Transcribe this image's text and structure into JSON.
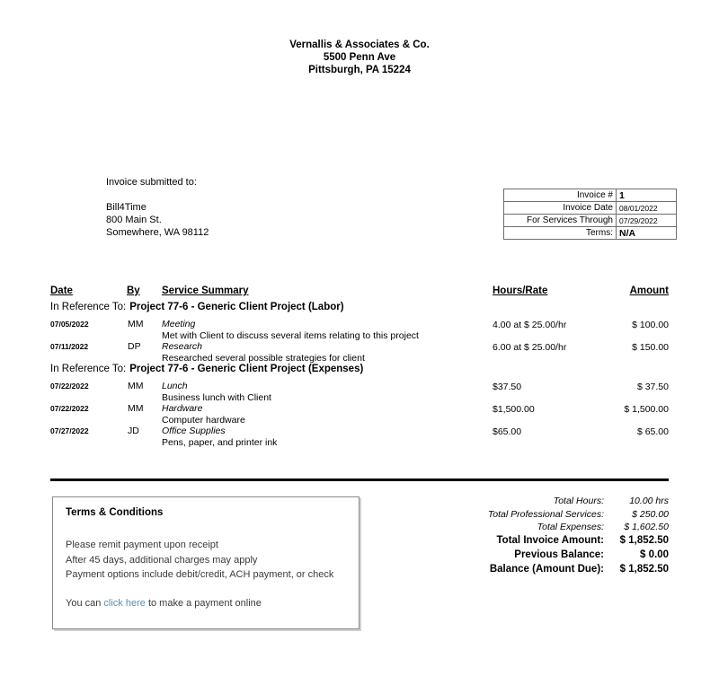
{
  "company": {
    "name": "Vernallis & Associates & Co.",
    "address_line": "5500 Penn Ave",
    "city_state_zip": "Pittsburgh, PA 15224"
  },
  "bill_to": {
    "heading": "Invoice submitted to:",
    "name": "Bill4Time",
    "street": "800 Main St.",
    "city_state_zip": "Somewhere, WA 98112"
  },
  "invoice_meta": [
    {
      "label": "Invoice #",
      "value": "1",
      "emphasis": "strong"
    },
    {
      "label": "Invoice Date",
      "value": "08/01/2022",
      "emphasis": "small"
    },
    {
      "label": "For Services Through",
      "value": "07/29/2022",
      "emphasis": "small"
    },
    {
      "label": "Terms:",
      "value": "N/A",
      "emphasis": "strong"
    }
  ],
  "columns": {
    "date": "Date",
    "by": "By",
    "service_summary": "Service Summary",
    "hours_rate": "Hours/Rate",
    "amount": "Amount"
  },
  "reference_label": "In Reference To:",
  "sections": [
    {
      "project": "Project 77-6 - Generic Client Project (Labor)",
      "items": [
        {
          "date": "07/05/2022",
          "by": "MM",
          "title": "Meeting",
          "description": "Met with Client to discuss several items relating to this project",
          "hours_rate": "4.00 at $ 25.00/hr",
          "amount": "$ 100.00"
        },
        {
          "date": "07/11/2022",
          "by": "DP",
          "title": "Research",
          "description": "Researched several possible strategies for client",
          "hours_rate": "6.00 at $ 25.00/hr",
          "amount": "$ 150.00"
        }
      ]
    },
    {
      "project": "Project 77-6 - Generic Client Project (Expenses)",
      "items": [
        {
          "date": "07/22/2022",
          "by": "MM",
          "title": "Lunch",
          "description": "Business lunch with Client",
          "hours_rate": "$37.50",
          "amount": "$ 37.50"
        },
        {
          "date": "07/22/2022",
          "by": "MM",
          "title": "Hardware",
          "description": "Computer hardware",
          "hours_rate": "$1,500.00",
          "amount": "$ 1,500.00"
        },
        {
          "date": "07/27/2022",
          "by": "JD",
          "title": "Office Supplies",
          "description": "Pens, paper, and printer ink",
          "hours_rate": "$65.00",
          "amount": "$ 65.00"
        }
      ]
    }
  ],
  "terms": {
    "title": "Terms & Conditions",
    "lines": [
      "Please remit payment upon receipt",
      "After 45 days, additional charges may apply",
      "Payment options include debit/credit, ACH payment, or check"
    ],
    "payment_prefix": "You can ",
    "payment_link": "click here",
    "payment_suffix": " to make a payment online",
    "link_color": "#5b8fb3"
  },
  "totals": [
    {
      "label": "Total Hours:",
      "value": "10.00 hrs",
      "style": "soft"
    },
    {
      "label": "Total Professional Services:",
      "value": "$ 250.00",
      "style": "soft"
    },
    {
      "label": "Total Expenses:",
      "value": "$ 1,602.50",
      "style": "soft"
    },
    {
      "label": "Total Invoice Amount:",
      "value": "$ 1,852.50",
      "style": "strong"
    },
    {
      "label": "Previous Balance:",
      "value": "$ 0.00",
      "style": "strong"
    },
    {
      "label": "Balance (Amount Due):",
      "value": "$ 1,852.50",
      "style": "strong"
    }
  ]
}
